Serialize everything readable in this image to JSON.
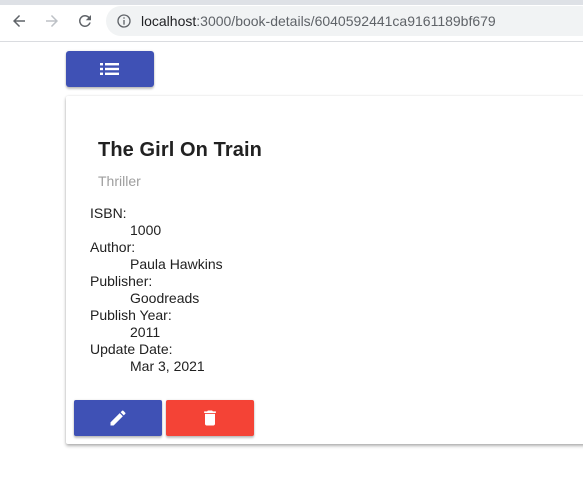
{
  "browser": {
    "url_host": "localhost",
    "url_rest": ":3000/book-details/6040592441ca9161189bf679"
  },
  "book": {
    "title": "The Girl On Train",
    "genre": "Thriller",
    "fields": [
      {
        "label": "ISBN:",
        "value": "1000"
      },
      {
        "label": "Author:",
        "value": "Paula Hawkins"
      },
      {
        "label": "Publisher:",
        "value": "Goodreads"
      },
      {
        "label": "Publish Year:",
        "value": "2011"
      },
      {
        "label": "Update Date:",
        "value": "Mar 3, 2021"
      }
    ]
  },
  "icons": {
    "list": "list-icon",
    "edit": "pencil-icon",
    "delete": "trash-icon"
  },
  "colors": {
    "primary": "#3f51b5",
    "danger": "#f44336",
    "subtitle": "#9e9e9e"
  }
}
